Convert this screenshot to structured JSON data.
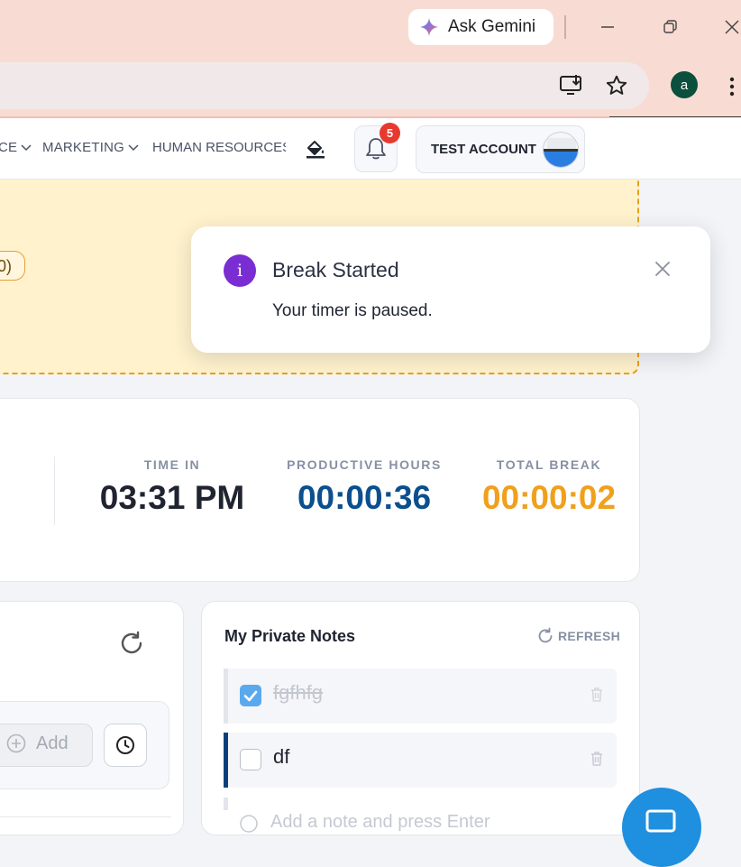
{
  "browser": {
    "gemini_label": "Ask Gemini",
    "profile_initial": "a",
    "icons": [
      "gemini-sparkle-icon",
      "minimize-icon",
      "restore-icon",
      "close-icon",
      "install-app-icon",
      "bookmark-star-icon",
      "more-vert-icon"
    ]
  },
  "nav": {
    "items": [
      {
        "label": "CE",
        "has_chevron": true
      },
      {
        "label": "MARKETING",
        "has_chevron": true
      },
      {
        "label": "HUMAN RESOURCES",
        "has_chevron": false
      }
    ],
    "notification_count": "5",
    "account_label": "TEST ACCOUNT"
  },
  "banner": {
    "pill_text": "0)"
  },
  "stats": {
    "time_in": {
      "label": "TIME IN",
      "value": "03:31 PM",
      "color": "#1f2430"
    },
    "productive": {
      "label": "PRODUCTIVE HOURS",
      "value": "00:00:36",
      "color": "#0b4f8e"
    },
    "total_break": {
      "label": "TOTAL BREAK",
      "value": "00:00:02",
      "color": "#f0a01c"
    }
  },
  "left_panel": {
    "add_label": "Add"
  },
  "notes": {
    "title": "My Private Notes",
    "refresh_label": "REFRESH",
    "items": [
      {
        "text": "fgfhfg",
        "done": true
      },
      {
        "text": "df",
        "done": false
      }
    ],
    "add_placeholder": "Add a note and press Enter"
  },
  "toast": {
    "title": "Break Started",
    "message": "Your timer is paused."
  },
  "colors": {
    "accent_purple": "#7a2dd2",
    "banner_yellow": "#fff2cc",
    "banner_border": "#e6a21a",
    "check_blue": "#5aa9ee",
    "note_bar_active": "#0b3f7a",
    "fab_blue": "#1f8fe0"
  }
}
